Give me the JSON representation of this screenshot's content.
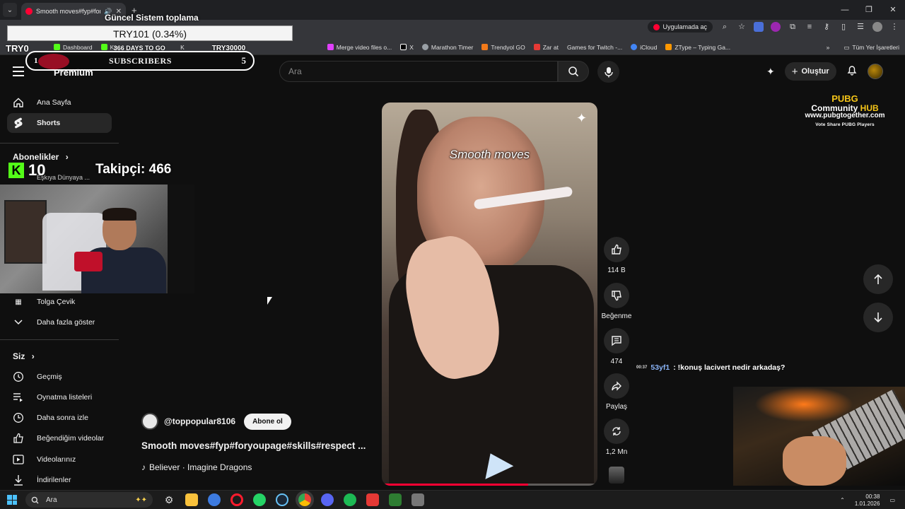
{
  "browser": {
    "tab_title": "Smooth moves#fyp#foryo...",
    "open_in_app": "Uygulamada aç",
    "bookmarks": [
      {
        "label": "Dashboard",
        "color": "#53fc18"
      },
      {
        "label": "Ku...",
        "color": "#53fc18"
      },
      {
        "label": "K",
        "color": "#53fc18"
      },
      {
        "label": "Merge video files o...",
        "color": "#e040fb"
      },
      {
        "label": "X",
        "color": "#ffffff"
      },
      {
        "label": "Marathon Timer",
        "color": "#9aa0a6"
      },
      {
        "label": "Trendyol GO",
        "color": "#f27a1a"
      },
      {
        "label": "Zar at",
        "color": "#e53935"
      },
      {
        "label": "Games for Twitch -...",
        "color": "#333333"
      },
      {
        "label": "iCloud",
        "color": "#4285f4"
      },
      {
        "label": "ZType – Typing Ga...",
        "color": "#ff9800"
      }
    ],
    "all_bookmarks": "Tüm Yer İşaretleri"
  },
  "overlay": {
    "title": "Güncel Sistem toplama",
    "ticker": "TRY101 (0.34%)",
    "ticker_left": "TRY0",
    "ticker_mid": "366 DAYS TO GO",
    "ticker_right": "TRY30000",
    "subs_left": "1",
    "subs_label": "SUBSCRIBERS",
    "subs_right": "5",
    "kick_count": "10",
    "followers": "Takipçi: 466",
    "pubg_line1": "PUBG",
    "pubg_line2a": "Community ",
    "pubg_line2b": "HUB",
    "pubg_line3": "www.pubgtogether.com",
    "pubg_line4": "Vote  Share  PUBG  Players",
    "chat_time": "00:37",
    "chat_user": "53yf1",
    "chat_msg": ": !konuş lacivert nedir arkadaş?"
  },
  "header": {
    "logo_text": "Premium",
    "search_placeholder": "Ara",
    "create_label": "Oluştur"
  },
  "sidebar": {
    "home": "Ana Sayfa",
    "shorts": "Shorts",
    "subscriptions": "Abonelikler",
    "sub_channel_1": "Eşkıya Dünyaya ...",
    "sub_channel_2": "Tolga Çevik",
    "show_more": "Daha fazla göster",
    "you": "Siz",
    "history": "Geçmiş",
    "playlists": "Oynatma listeleri",
    "watch_later": "Daha sonra izle",
    "liked": "Beğendiğim videolar",
    "your_videos": "Videolarınız",
    "downloads": "İndirilenler"
  },
  "video": {
    "caption": "Smooth moves",
    "progress": 0.68,
    "channel": "@toppopular8106",
    "subscribe": "Abone ol",
    "title": "Smooth moves#fyp#foryoupage#skills#respect ...",
    "music": "Believer · Imagine Dragons"
  },
  "actions": {
    "likes": "114 B",
    "dislike": "Beğenme",
    "comments": "474",
    "share": "Paylaş",
    "remix": "1,2 Mn"
  },
  "taskbar": {
    "search": "Ara",
    "time": "00:38",
    "date": "1.01.2026"
  }
}
